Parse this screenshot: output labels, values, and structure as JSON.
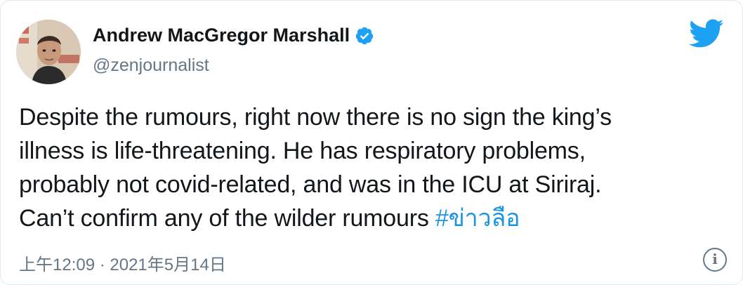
{
  "author": {
    "display_name": "Andrew MacGregor Marshall",
    "handle": "@zenjournalist",
    "verified": true,
    "avatar_icon": "avatar-photo"
  },
  "tweet": {
    "lines": [
      "Despite the rumours, right now there is no sign the king’s",
      "illness is life-threatening. He has respiratory problems,",
      "probably not covid-related, and was in the ICU at Siriraj.",
      "Can’t confirm any of the wilder rumours "
    ],
    "hashtag": "#ข่าวลือ"
  },
  "timestamp": "上午12:09 · 2021年5月14日",
  "icons": {
    "logo": "twitter-bird-icon",
    "verified": "verified-badge-icon",
    "info": "info-icon"
  },
  "colors": {
    "brand_blue": "#1da1f2",
    "link_blue": "#1b95e0",
    "secondary_text": "#657786",
    "primary_text": "#14171a"
  }
}
